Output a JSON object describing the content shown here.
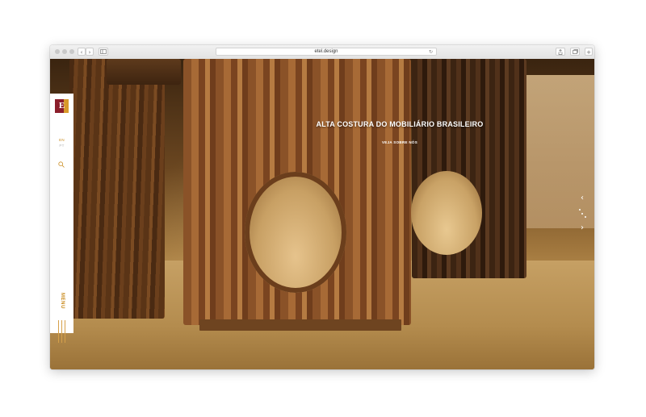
{
  "browser": {
    "url": "etel.design",
    "nav_back": "‹",
    "nav_forward": "›",
    "reload_glyph": "↻"
  },
  "sidebar": {
    "logo_letter": "E",
    "lang_en": "EN",
    "lang_pt": "PT",
    "menu_label": "MENU"
  },
  "hero": {
    "title": "ALTA COSTURA DO MOBILIÁRIO BRASILEIRO",
    "link": "VEJA SOBRE NÓS"
  },
  "slider": {
    "prev_glyph": "‹",
    "next_glyph": "›"
  },
  "colors": {
    "brand_red": "#8b1e2b",
    "brand_gold": "#d89a2a",
    "accent": "#c98a1c"
  },
  "icons": [
    "search-icon",
    "share-icon",
    "tabs-icon",
    "sidebar-icon",
    "reload-icon"
  ]
}
